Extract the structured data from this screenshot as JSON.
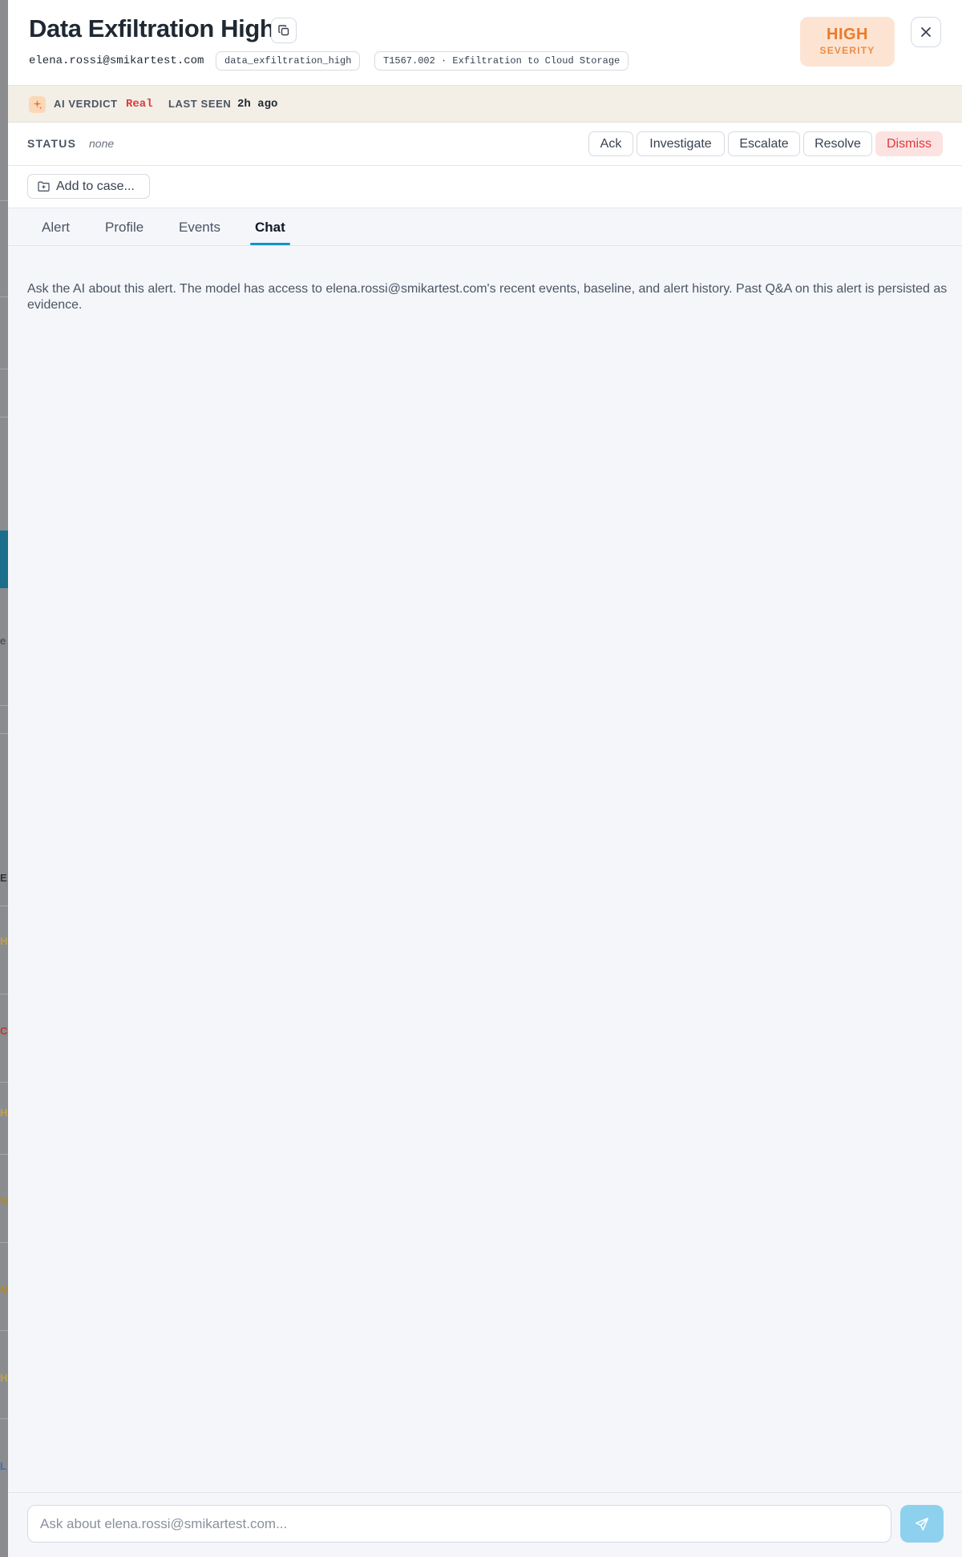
{
  "background": {
    "fragments": [
      "e",
      "E",
      "H",
      "C",
      "H",
      "M",
      "M",
      "H",
      "L"
    ]
  },
  "alert": {
    "title": "Data Exfiltration High",
    "user_email": "elena.rossi@smikartest.com",
    "rule_tag": "data_exfiltration_high",
    "mitre_tag": "T1567.002 · Exfiltration to Cloud Storage",
    "severity_level": "HIGH",
    "severity_label": "SEVERITY",
    "severity_color": "#ea7a2b"
  },
  "verdict": {
    "ai_label": "AI VERDICT",
    "ai_value": "Real",
    "last_seen_label": "LAST SEEN",
    "last_seen_value": "2h ago"
  },
  "status": {
    "label": "STATUS",
    "value": "none",
    "actions": {
      "ack": "Ack",
      "investigate": "Investigate",
      "escalate": "Escalate",
      "resolve": "Resolve",
      "dismiss": "Dismiss"
    }
  },
  "case": {
    "add_label": "Add to case..."
  },
  "tabs": {
    "alert": "Alert",
    "profile": "Profile",
    "events": "Events",
    "chat": "Chat",
    "active": "Chat"
  },
  "chat": {
    "intro": "Ask the AI about this alert. The model has access to elena.rossi@smikartest.com's recent events, baseline, and alert history. Past Q&A on this alert is persisted as evidence.",
    "input_value": "",
    "input_placeholder": "Ask about elena.rossi@smikartest.com..."
  },
  "icons": {
    "copy": "copy-icon",
    "close": "close-icon",
    "ai": "sparkles-icon",
    "case": "folder-plus-icon",
    "send": "send-icon"
  },
  "colors": {
    "accent": "#1593c9",
    "danger": "#dc3b3b",
    "severity_bg": "#fde4d2",
    "send_bg": "#8ed1ef"
  }
}
